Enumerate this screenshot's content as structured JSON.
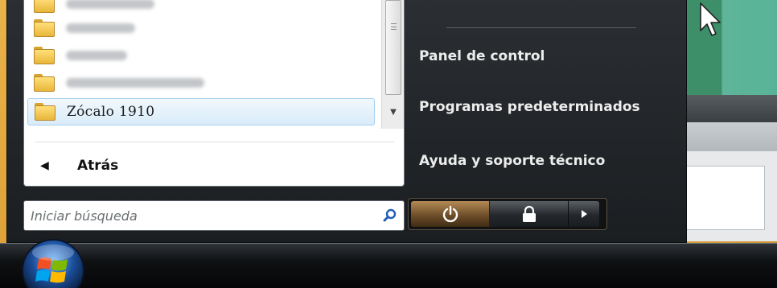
{
  "left_pane": {
    "selected_item": "Zócalo 1910",
    "back_label": "Atrás"
  },
  "search": {
    "placeholder": "Iniciar búsqueda"
  },
  "right_pane": {
    "items": [
      "Panel de control",
      "Programas predeterminados",
      "Ayuda y soporte técnico"
    ]
  },
  "icons": {
    "folder": "folder-icon",
    "search": "search-icon",
    "power": "power-icon",
    "lock": "lock-icon",
    "arrow": "arrow-right-icon",
    "start": "windows-logo-icon"
  },
  "colors": {
    "menu_dark": "#1b1e21",
    "power_accent": "#8a6535",
    "selection": "#d9ecf9",
    "search_icon": "#1f5fb3"
  }
}
